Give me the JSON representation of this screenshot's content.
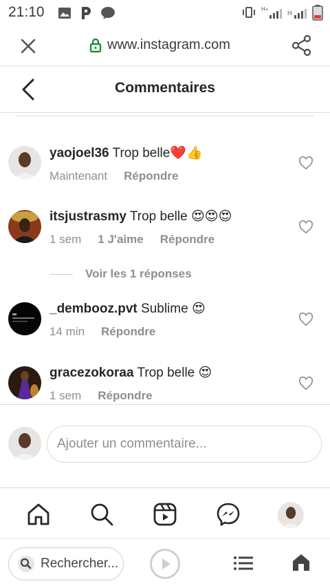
{
  "status": {
    "time": "21:10",
    "left_icons": [
      "image-icon",
      "parking-app-icon",
      "chat-bubble-icon"
    ],
    "right_icons": [
      "vibrate-icon",
      "signal-h-plus-icon",
      "signal-h-icon",
      "signal-bars-icon",
      "battery-low-icon"
    ]
  },
  "browser": {
    "url": "www.instagram.com",
    "search_label": "Rechercher..."
  },
  "header": {
    "title": "Commentaires"
  },
  "comments": [
    {
      "user": "yaojoel36",
      "text": "Trop belle❤️👍",
      "time": "Maintenant",
      "likes": "",
      "reply": "Répondre"
    },
    {
      "user": "itsjustrasmy",
      "text": "Trop belle 😍😍😍",
      "time": "1 sem",
      "likes": "1 J'aime",
      "reply": "Répondre"
    },
    {
      "user": "_dembooz.pvt",
      "text": "Sublime 😍",
      "time": "14 min",
      "likes": "",
      "reply": "Répondre"
    },
    {
      "user": "gracezokoraa",
      "text": "Trop belle 😍",
      "time": "1 sem",
      "likes": "",
      "reply": "Répondre"
    }
  ],
  "replies_link": "Voir les 1 réponses",
  "composer": {
    "placeholder": "Ajouter un commentaire..."
  },
  "tabs": [
    "home-icon",
    "search-icon",
    "reels-icon",
    "messenger-icon",
    "profile-avatar"
  ],
  "colors": {
    "text": "#262626",
    "secondary": "#8e8e8e",
    "border": "#dbdbdb",
    "lock_green": "#1e8e3e",
    "heart_red": "#e0245e"
  }
}
